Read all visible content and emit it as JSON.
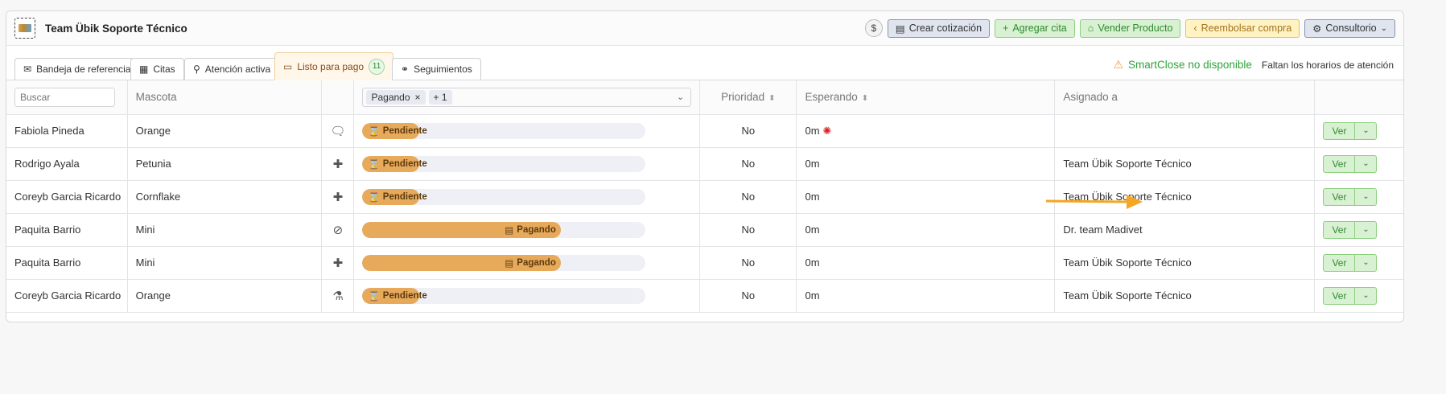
{
  "header": {
    "title": "Team Übik Soporte Técnico",
    "dollar_label": "$",
    "create_quote_label": "Crear cotización",
    "add_appointment_label": "Agregar cita",
    "sell_product_label": "Vender Producto",
    "refund_label": "Reembolsar compra",
    "office_label": "Consultorio"
  },
  "tabs": [
    {
      "label": "Bandeja de referencias"
    },
    {
      "label": "Citas"
    },
    {
      "label": "Atención activa"
    },
    {
      "label": "Listo para pago",
      "badge": "11",
      "active": true
    },
    {
      "label": "Seguimientos"
    }
  ],
  "smartclose": {
    "status": "SmartClose no disponible",
    "reason": "Faltan los horarios de atención"
  },
  "table": {
    "search_placeholder": "Buscar",
    "columns": {
      "mascota": "Mascota",
      "prioridad": "Prioridad",
      "esperando": "Esperando",
      "asignado": "Asignado a"
    },
    "filter_chip": "Pagando",
    "filter_more": "+ 1",
    "rows": [
      {
        "name": "Fabiola Pineda",
        "pet": "Orange",
        "icon": "chat-icon",
        "status": "Pendiente",
        "progress": 0.2,
        "priority": "No",
        "waiting": "0m",
        "alert": true,
        "assigned": "",
        "action": "Ver"
      },
      {
        "name": "Rodrigo Ayala",
        "pet": "Petunia",
        "icon": "plus-cross-icon",
        "status": "Pendiente",
        "progress": 0.2,
        "priority": "No",
        "waiting": "0m",
        "alert": false,
        "assigned": "Team Übik Soporte Técnico",
        "action": "Ver"
      },
      {
        "name": "Coreyb Garcia Ricardo",
        "pet": "Cornflake",
        "icon": "plus-cross-icon",
        "status": "Pendiente",
        "progress": 0.2,
        "priority": "No",
        "waiting": "0m",
        "alert": false,
        "assigned": "Team Übik Soporte Técnico",
        "action": "Ver"
      },
      {
        "name": "Paquita Barrio",
        "pet": "Mini",
        "icon": "bandage-icon",
        "status": "Pagando",
        "progress": 0.7,
        "priority": "No",
        "waiting": "0m",
        "alert": false,
        "assigned": "Dr. team Madivet",
        "action": "Ver"
      },
      {
        "name": "Paquita Barrio",
        "pet": "Mini",
        "icon": "plus-cross-icon",
        "status": "Pagando",
        "progress": 0.7,
        "priority": "No",
        "waiting": "0m",
        "alert": false,
        "assigned": "Team Übik Soporte Técnico",
        "action": "Ver"
      },
      {
        "name": "Coreyb Garcia Ricardo",
        "pet": "Orange",
        "icon": "flask-icon",
        "status": "Pendiente",
        "progress": 0.2,
        "priority": "No",
        "waiting": "0m",
        "alert": false,
        "assigned": "Team Übik Soporte Técnico",
        "action": "Ver"
      }
    ]
  },
  "colors": {
    "progress_fill": "#e7a95a",
    "accent_green": "#2fa33a",
    "arrow": "#f5a623"
  }
}
